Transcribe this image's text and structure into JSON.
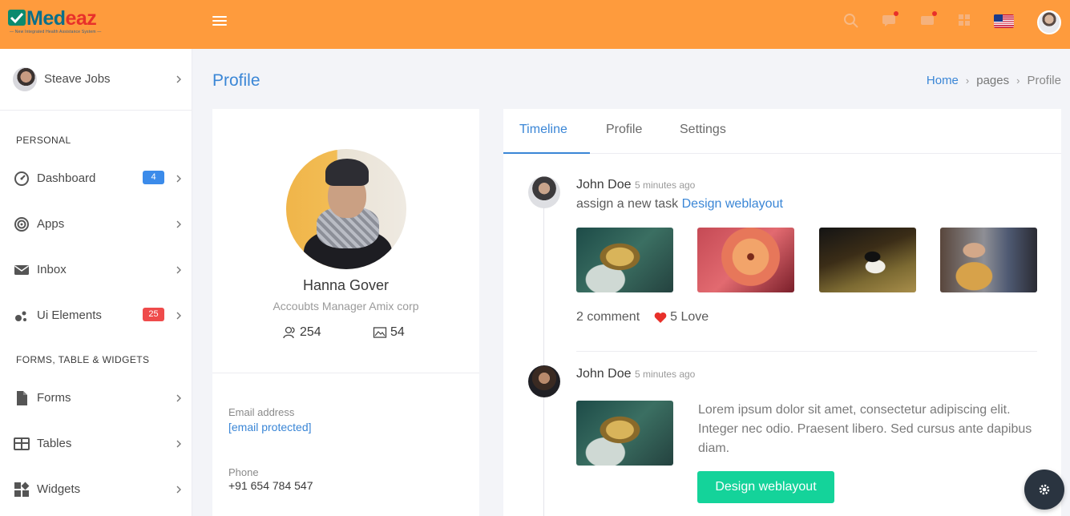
{
  "app": {
    "brand": "Medeaz",
    "brand_prefix": "Med",
    "brand_suffix": "eaz",
    "tagline": "— New Integrated Health Assistance System —",
    "accent": "#fe9b3d",
    "link_color": "#3a86d6"
  },
  "topbar": {
    "icons": [
      "hamburger-icon",
      "search-icon",
      "message-icon",
      "mail-icon",
      "grid-icon",
      "us-flag-icon",
      "avatar"
    ]
  },
  "sidebar": {
    "user_name": "Steave Jobs",
    "section_personal": "PERSONAL",
    "section_forms": "FORMS, TABLE & WIDGETS",
    "items": [
      {
        "label": "Dashboard",
        "icon": "dashboard-icon",
        "badge": "4",
        "badge_color": "#3b8bea"
      },
      {
        "label": "Apps",
        "icon": "target-icon"
      },
      {
        "label": "Inbox",
        "icon": "envelope-icon"
      },
      {
        "label": "Ui Elements",
        "icon": "bubbles-icon",
        "badge": "25",
        "badge_color": "#ef4b4b"
      },
      {
        "label": "Forms",
        "icon": "document-icon"
      },
      {
        "label": "Tables",
        "icon": "table-icon"
      },
      {
        "label": "Widgets",
        "icon": "widgets-icon"
      }
    ]
  },
  "page": {
    "title": "Profile",
    "breadcrumb": {
      "home": "Home",
      "middle": "pages",
      "current": "Profile"
    }
  },
  "profile": {
    "name": "Hanna Gover",
    "role": "Accoubts Manager Amix corp",
    "followers": "254",
    "photos": "54",
    "email_label": "Email address",
    "email_value": "[email protected]",
    "phone_label": "Phone",
    "phone_value": "+91 654 784 547"
  },
  "tabs": [
    {
      "label": "Timeline",
      "active": true
    },
    {
      "label": "Profile",
      "active": false
    },
    {
      "label": "Settings",
      "active": false
    }
  ],
  "timeline": [
    {
      "author": "John Doe",
      "time": "5 minutes ago",
      "text": "assign a new task ",
      "link": "Design weblayout",
      "comments": "2 comment",
      "loves": "5 Love"
    },
    {
      "author": "John Doe",
      "time": "5 minutes ago",
      "body": "Lorem ipsum dolor sit amet, consectetur adipiscing elit. Integer nec odio. Praesent libero. Sed cursus ante dapibus diam.",
      "button": "Design weblayout"
    }
  ]
}
